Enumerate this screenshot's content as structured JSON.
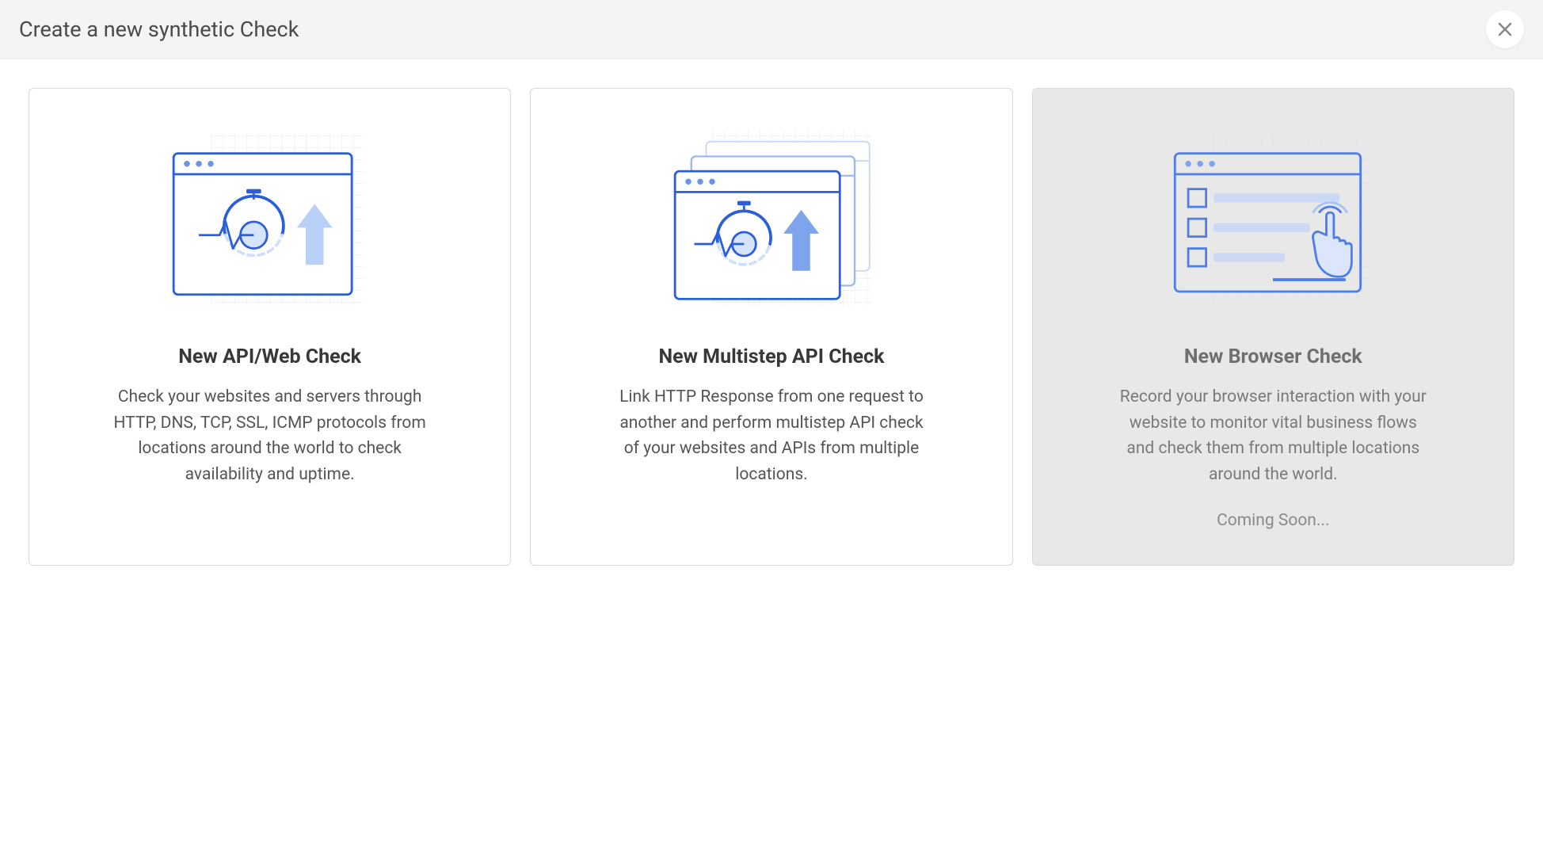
{
  "header": {
    "title": "Create a new synthetic Check"
  },
  "cards": [
    {
      "title": "New API/Web Check",
      "desc": "Check your websites and servers through HTTP, DNS, TCP, SSL, ICMP protocols from locations around the world to check availability and uptime.",
      "disabled": false,
      "status": ""
    },
    {
      "title": "New Multistep API Check",
      "desc": "Link HTTP Response from one request to another and perform multistep API check of your websites and APIs from multiple locations.",
      "disabled": false,
      "status": ""
    },
    {
      "title": "New Browser Check",
      "desc": "Record your browser interaction with your website to monitor vital business flows and check them from multiple locations around the world.",
      "disabled": true,
      "status": "Coming Soon..."
    }
  ]
}
